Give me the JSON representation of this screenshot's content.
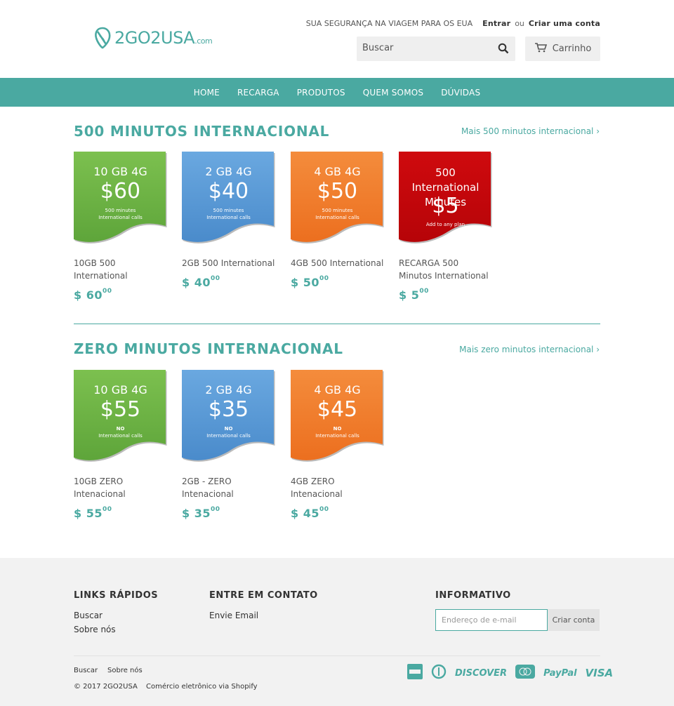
{
  "brand": {
    "logo_text": "2GO2USA",
    "logo_suffix": ".com"
  },
  "topbar": {
    "tagline": "SUA SEGURANÇA NA VIAGEM PARA OS EUA",
    "login": "Entrar",
    "or": "ou",
    "signup": "Criar uma conta"
  },
  "search": {
    "placeholder": "Buscar"
  },
  "cart": {
    "label": "Carrinho"
  },
  "nav": [
    "HOME",
    "RECARGA",
    "PRODUTOS",
    "QUEM SOMOS",
    "DÚVIDAS"
  ],
  "sections": [
    {
      "title": "500 MINUTOS INTERNACIONAL",
      "more": "Mais 500 minutos internacional ›",
      "products": [
        {
          "color": "green",
          "card_gb": "10 GB 4G",
          "card_price": "$60",
          "card_sub1": "500 minutes",
          "card_sub2": "International calls",
          "name": "10GB 500 International",
          "price_main": "$ 60",
          "price_cents": "00"
        },
        {
          "color": "blue",
          "card_gb": "2 GB 4G",
          "card_price": "$40",
          "card_sub1": "500 minutes",
          "card_sub2": "International calls",
          "name": "2GB 500 International",
          "price_main": "$ 40",
          "price_cents": "00"
        },
        {
          "color": "orange",
          "card_gb": "4 GB 4G",
          "card_price": "$50",
          "card_sub1": "500 minutes",
          "card_sub2": "International calls",
          "name": "4GB 500 International",
          "price_main": "$ 50",
          "price_cents": "00"
        },
        {
          "color": "red",
          "card_gb": "500 International Minutes",
          "card_price": "$5",
          "card_sub1": "Add to any plan",
          "card_sub2": "",
          "name": "RECARGA 500 Minutos International",
          "price_main": "$ 5",
          "price_cents": "00"
        }
      ]
    },
    {
      "title": "ZERO MINUTOS INTERNACIONAL",
      "more": "Mais zero minutos internacional ›",
      "products": [
        {
          "color": "green",
          "card_gb": "10 GB 4G",
          "card_price": "$55",
          "card_sub1": "NO",
          "card_sub2": "International calls",
          "name": "10GB ZERO Intenacional",
          "price_main": "$ 55",
          "price_cents": "00"
        },
        {
          "color": "blue",
          "card_gb": "2 GB 4G",
          "card_price": "$35",
          "card_sub1": "NO",
          "card_sub2": "International calls",
          "name": "2GB - ZERO Intenacional",
          "price_main": "$ 35",
          "price_cents": "00"
        },
        {
          "color": "orange",
          "card_gb": "4 GB 4G",
          "card_price": "$45",
          "card_sub1": "NO",
          "card_sub2": "International calls",
          "name": "4GB ZERO Intenacional",
          "price_main": "$ 45",
          "price_cents": "00"
        }
      ]
    }
  ],
  "footer": {
    "quick_links": {
      "title": "LINKS RÁPIDOS",
      "items": [
        "Buscar",
        "Sobre nós"
      ]
    },
    "contact": {
      "title": "ENTRE EM CONTATO",
      "items": [
        "Envie Email"
      ]
    },
    "newsletter": {
      "title": "INFORMATIVO",
      "placeholder": "Endereço de e-mail",
      "button": "Criar conta"
    },
    "bottom_links": [
      "Buscar",
      "Sobre nós"
    ],
    "copyright": "© 2017 2GO2USA",
    "powered": "Comércio eletrônico via Shopify",
    "payments": [
      "DISCOVER",
      "PayPal",
      "VISA"
    ]
  },
  "colors": {
    "accent": "#4aa9a1",
    "green": "#6ab344",
    "blue": "#5b9bd5",
    "orange": "#f07f2e",
    "red": "#c5070b"
  }
}
